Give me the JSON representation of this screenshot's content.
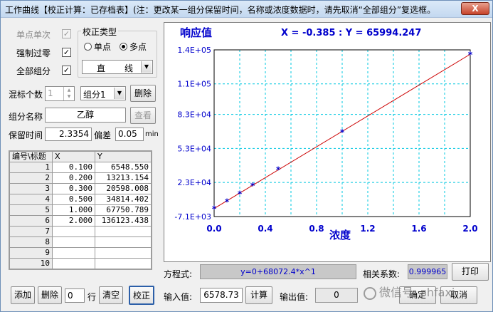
{
  "window": {
    "title": "工作曲线【校正计算：已存档表】(注：更改某一组分保留时间，名称或浓度数据时，请先取消“全部组分”复选框。",
    "close_label": "X"
  },
  "left": {
    "single_point_label": "单点单次",
    "single_point_checked": "✓",
    "force_zero_label": "强制过零",
    "force_zero_checked": "✓",
    "all_groups_label": "全部组分",
    "all_groups_checked": "✓",
    "calib_group_title": "校正类型",
    "radio_single": "单点",
    "radio_multi": "多点",
    "curve_type": "直　　线",
    "mix_count_label": "混标个数",
    "mix_count_value": "1",
    "group_select": "组分1",
    "delete_label": "删除",
    "group_name_label": "组分名称",
    "group_name_value": "乙醇",
    "view_label": "查看",
    "retention_label": "保留时间",
    "retention_value": "2.3354",
    "deviation_label": "偏差",
    "deviation_value": "0.05",
    "deviation_unit": "min"
  },
  "table": {
    "headers": [
      "编号\\标题",
      "X",
      "Y"
    ],
    "rows": [
      {
        "id": "1",
        "x": "0.100",
        "y": "6548.550"
      },
      {
        "id": "2",
        "x": "0.200",
        "y": "13213.154"
      },
      {
        "id": "3",
        "x": "0.300",
        "y": "20598.008"
      },
      {
        "id": "4",
        "x": "0.500",
        "y": "34814.402"
      },
      {
        "id": "5",
        "x": "1.000",
        "y": "67750.789"
      },
      {
        "id": "6",
        "x": "2.000",
        "y": "136123.438"
      },
      {
        "id": "7",
        "x": "",
        "y": ""
      },
      {
        "id": "8",
        "x": "",
        "y": ""
      },
      {
        "id": "9",
        "x": "",
        "y": ""
      },
      {
        "id": "10",
        "x": "",
        "y": ""
      }
    ]
  },
  "bottom_left": {
    "add_label": "添加",
    "delete_label": "删除",
    "row_value": "0",
    "row_label": "行",
    "clear_label": "清空",
    "calibrate_label": "校正"
  },
  "chart_data": {
    "type": "scatter",
    "ylabel": "响应值",
    "xlabel": "浓度",
    "cursor_readout": "X = -0.385 : Y = 65994.247",
    "xlim": [
      0.0,
      2.0
    ],
    "ylim": [
      -7100,
      140000
    ],
    "x_ticks": [
      "0.0",
      "0.4",
      "0.8",
      "1.2",
      "1.6",
      "2.0"
    ],
    "x_tick_values": [
      0.0,
      0.4,
      0.8,
      1.2,
      1.6,
      2.0
    ],
    "y_ticks": [
      "-7.1E+03",
      "2.3E+04",
      "5.3E+04",
      "8.3E+04",
      "1.1E+05",
      "1.4E+05"
    ],
    "y_tick_values": [
      -7100,
      23000,
      53000,
      83000,
      110000,
      140000
    ],
    "points": [
      {
        "x": 0.0,
        "y": 0
      },
      {
        "x": 0.1,
        "y": 6548.55
      },
      {
        "x": 0.2,
        "y": 13213.154
      },
      {
        "x": 0.3,
        "y": 20598.008
      },
      {
        "x": 0.5,
        "y": 34814.402
      },
      {
        "x": 1.0,
        "y": 67750.789
      },
      {
        "x": 2.0,
        "y": 136123.438
      }
    ],
    "fit_line": {
      "slope": 68072.4,
      "intercept": 0
    },
    "colors": {
      "axis_text": "#0000cc",
      "grid": "#00c8e0",
      "fit": "#cc0000",
      "points": "#0000cc"
    },
    "grid": true
  },
  "bottom": {
    "equation_label": "方程式:",
    "equation_value": "y=0+68072.4*x^1",
    "corr_label": "相关系数:",
    "corr_value": "0.999965",
    "print_label": "打印",
    "input_label": "输入值:",
    "input_value": "6578.73",
    "calc_label": "计算",
    "output_label": "输出值:",
    "output_value": "0",
    "ok_label": "确定",
    "cancel_label": "取消"
  },
  "watermark": "微信号: shfaxi"
}
